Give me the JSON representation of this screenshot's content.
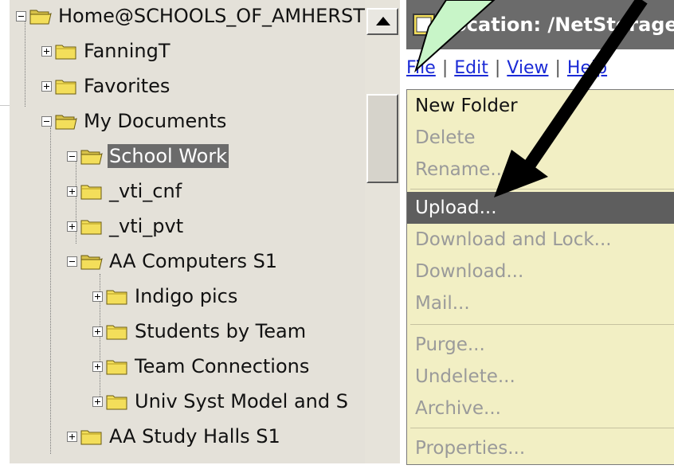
{
  "tree": {
    "items": [
      {
        "label": "Home@SCHOOLS_OF_AMHERST",
        "expander": "minus",
        "open": true
      },
      {
        "label": "FanningT",
        "expander": "plus",
        "open": false
      },
      {
        "label": "Favorites",
        "expander": "plus",
        "open": false
      },
      {
        "label": "My Documents",
        "expander": "minus",
        "open": true
      },
      {
        "label": "School Work",
        "expander": "minus",
        "open": true,
        "selected": true
      },
      {
        "label": "_vti_cnf",
        "expander": "plus",
        "open": false
      },
      {
        "label": "_vti_pvt",
        "expander": "plus",
        "open": false
      },
      {
        "label": "AA Computers S1",
        "expander": "minus",
        "open": true
      },
      {
        "label": "Indigo pics",
        "expander": "plus",
        "open": false
      },
      {
        "label": "Students by Team",
        "expander": "plus",
        "open": false
      },
      {
        "label": "Team Connections",
        "expander": "plus",
        "open": false
      },
      {
        "label": "Univ Syst Model and S",
        "expander": "plus",
        "open": false
      },
      {
        "label": "AA Study Halls S1",
        "expander": "plus",
        "open": false
      }
    ]
  },
  "window": {
    "title": "Location: /NetStorage"
  },
  "menubar": {
    "file": "File",
    "edit": "Edit",
    "view": "View",
    "help": "Help",
    "separator": "|"
  },
  "file_menu": {
    "items": [
      {
        "label": "New Folder",
        "state": "enabled"
      },
      {
        "label": "Delete",
        "state": "disabled"
      },
      {
        "label": "Rename...",
        "state": "disabled"
      },
      {
        "label": "Upload...",
        "state": "highlighted"
      },
      {
        "label": "Download and Lock...",
        "state": "disabled"
      },
      {
        "label": "Download...",
        "state": "disabled"
      },
      {
        "label": "Mail...",
        "state": "disabled"
      },
      {
        "label": "Purge...",
        "state": "disabled"
      },
      {
        "label": "Undelete...",
        "state": "disabled"
      },
      {
        "label": "Archive...",
        "state": "disabled"
      },
      {
        "label": "Properties...",
        "state": "disabled"
      }
    ]
  },
  "colors": {
    "tree_bg": "#e4e1d9",
    "selection": "#6b6b6b",
    "menu_bg": "#f2efc4",
    "menu_highlight": "#5e5e5e",
    "link": "#1a2ad6",
    "callout_fill": "#c8f5c8",
    "folder_yellow": "#f3de5a"
  }
}
